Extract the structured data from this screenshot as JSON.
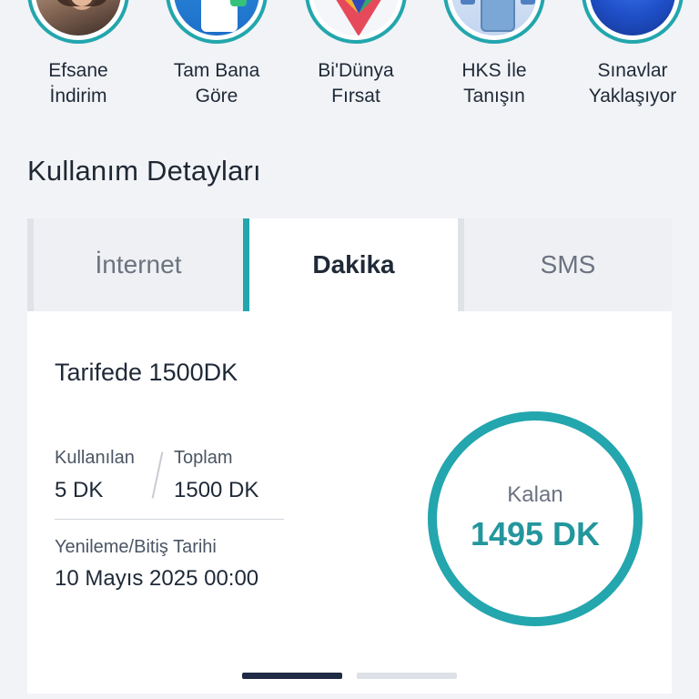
{
  "stories": [
    {
      "line1": "Efsane",
      "line2": "İndirim"
    },
    {
      "line1": "Tam Bana",
      "line2": "Göre"
    },
    {
      "line1": "Bi'Dünya",
      "line2": "Fırsat"
    },
    {
      "line1": "HKS İle",
      "line2": "Tanışın"
    },
    {
      "line1": "Sınavlar",
      "line2": "Yaklaşıyor"
    }
  ],
  "section": {
    "title": "Kullanım Detayları"
  },
  "tabs": [
    {
      "label": "İnternet",
      "active": false
    },
    {
      "label": "Dakika",
      "active": true
    },
    {
      "label": "SMS",
      "active": false
    }
  ],
  "card": {
    "title": "Tarifede 1500DK",
    "used_label": "Kullanılan",
    "used_value": "5 DK",
    "total_label": "Toplam",
    "total_value": "1500 DK",
    "renew_label": "Yenileme/Bitiş Tarihi",
    "renew_value": "10 Mayıs 2025 00:00",
    "remaining_label": "Kalan",
    "remaining_value": "1495 DK",
    "remaining_fraction": 0.9967
  },
  "pager": {
    "count": 2,
    "active_index": 0
  },
  "colors": {
    "accent": "#23a6ad",
    "accent_text": "#23969d",
    "pager_active": "#1f2a44",
    "pager_inactive": "#dde1e7"
  }
}
